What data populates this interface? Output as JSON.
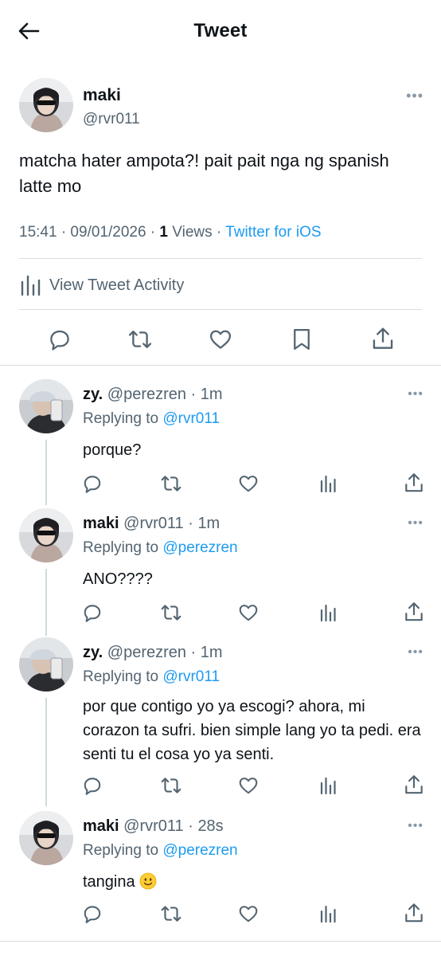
{
  "header": {
    "title": "Tweet",
    "back_icon": "arrow-left-icon"
  },
  "main_tweet": {
    "name": "maki",
    "handle": "@rvr011",
    "more": "•••",
    "text": "matcha hater ampota?! pait pait nga ng spanish latte mo",
    "time": "15:41 · 09/01/2026 · ",
    "views_count": "1",
    "views_label": " Views · ",
    "source": "Twitter for iOS",
    "activity_label": "View Tweet Activity",
    "actions": [
      "reply-icon",
      "retweet-icon",
      "like-icon",
      "bookmark-icon",
      "share-icon"
    ]
  },
  "replies": [
    {
      "name": "zy.",
      "handle": "@perezren · 1m",
      "replying_prefix": "Replying to ",
      "replying_to": "@rvr011",
      "text": "porque?",
      "more": "•••"
    },
    {
      "name": "maki",
      "handle": "@rvr011 · 1m",
      "replying_prefix": "Replying to ",
      "replying_to": "@perezren",
      "text": "ANO????",
      "more": "•••"
    },
    {
      "name": "zy.",
      "handle": "@perezren · 1m",
      "replying_prefix": "Replying to ",
      "replying_to": "@rvr011",
      "text": "por que contigo yo ya escogi? ahora, mi corazon ta sufri. bien simple lang yo ta pedi. era senti tu el cosa yo ya senti.",
      "more": "•••"
    },
    {
      "name": "maki",
      "handle": "@rvr011 · 28s",
      "replying_prefix": "Replying to ",
      "replying_to": "@perezren",
      "text": "tangina ",
      "emoji": "slightly-smiling-face-emoji",
      "more": "•••"
    }
  ],
  "colors": {
    "link": "#1d9bf0",
    "secondary": "#536471",
    "divider": "#d9dde1",
    "icon": "#536471"
  }
}
